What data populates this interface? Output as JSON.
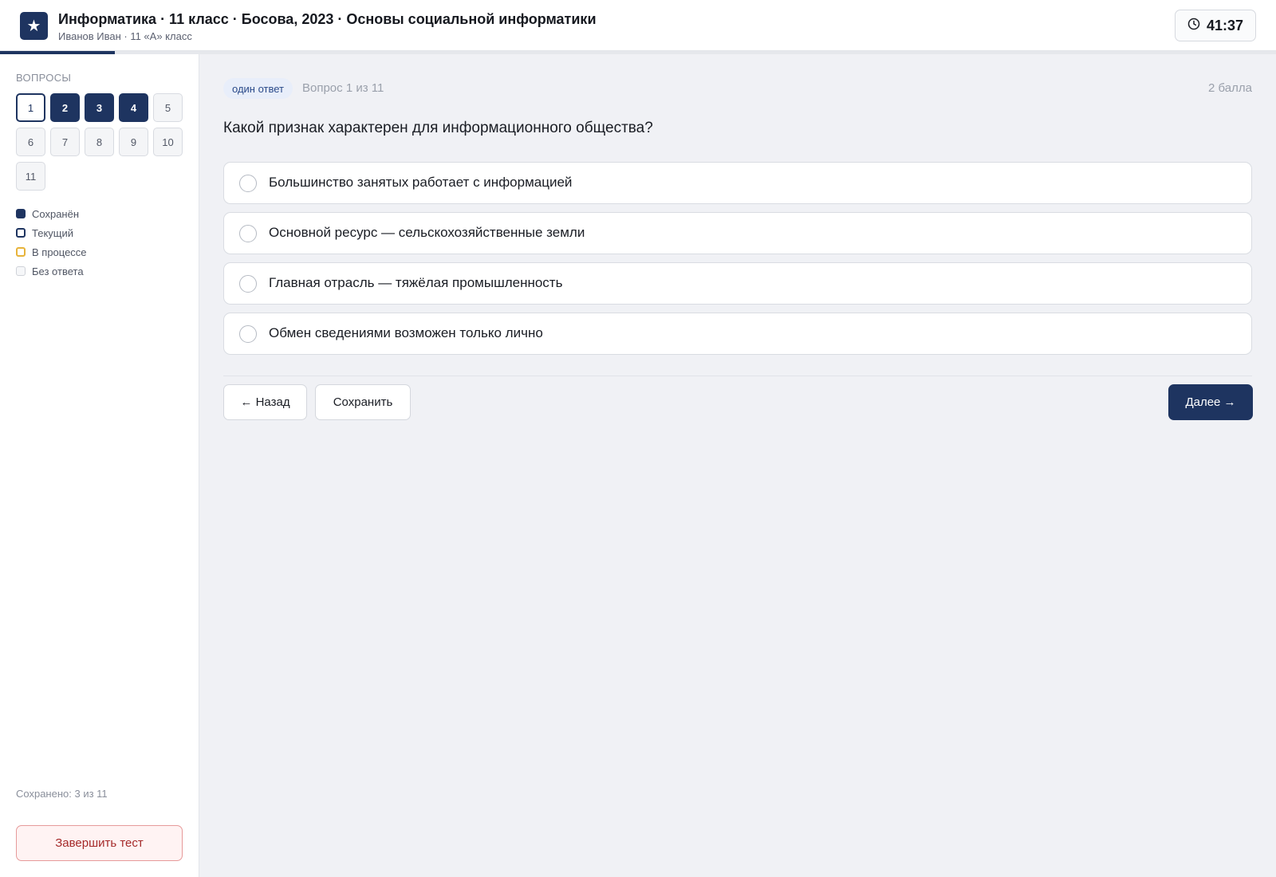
{
  "header": {
    "logo_glyph": "★",
    "title": "Информатика · 11 класс · Босова, 2023 · Основы социальной информатики",
    "subtitle": "Иванов Иван · 11 «А» класс",
    "timer": "41:37",
    "progress_fraction": 0.09
  },
  "sidebar": {
    "heading": "Вопросы",
    "questions": [
      {
        "number": "1",
        "state": "current"
      },
      {
        "number": "2",
        "state": "saved"
      },
      {
        "number": "3",
        "state": "saved"
      },
      {
        "number": "4",
        "state": "saved"
      },
      {
        "number": "5",
        "state": "none"
      },
      {
        "number": "6",
        "state": "none"
      },
      {
        "number": "7",
        "state": "none"
      },
      {
        "number": "8",
        "state": "none"
      },
      {
        "number": "9",
        "state": "none"
      },
      {
        "number": "10",
        "state": "none"
      },
      {
        "number": "11",
        "state": "none"
      }
    ],
    "legend": {
      "saved": "Сохранён",
      "current": "Текущий",
      "in_progress": "В процессе",
      "no_answer": "Без ответа"
    },
    "saved_count": "Сохранено: 3 из 11",
    "finish_label": "Завершить тест"
  },
  "question": {
    "type_badge": "один ответ",
    "counter": "Вопрос 1 из 11",
    "points": "2 балла",
    "text": "Какой признак характерен для информационного общества?",
    "options": [
      "Большинство занятых работает с информацией",
      "Основной ресурс — сельскохозяйственные земли",
      "Главная отрасль — тяжёлая промышленность",
      "Обмен сведениями возможен только лично"
    ]
  },
  "nav": {
    "back_label": "← Назад",
    "save_label": "Сохранить",
    "next_label": "Далее →"
  },
  "colors": {
    "accent": "#1e3460",
    "in_progress": "#e7b33a",
    "danger": "#a52a2a"
  }
}
